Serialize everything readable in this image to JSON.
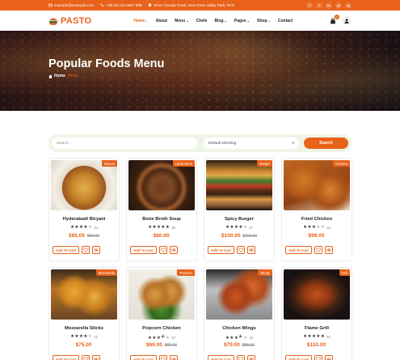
{
  "topbar": {
    "email": "example@example.com",
    "phone": "+88 (0) 123 4567 888",
    "address": "Inner Circular Road, New Rose Valley Park, NYZ",
    "socials": [
      "f",
      "t",
      "in",
      "yt",
      "ig"
    ]
  },
  "header": {
    "logo": "PASTO",
    "nav": [
      {
        "label": "Home",
        "dropdown": true,
        "active": true
      },
      {
        "label": "About",
        "dropdown": false
      },
      {
        "label": "Menu",
        "dropdown": true
      },
      {
        "label": "Chefs",
        "dropdown": false
      },
      {
        "label": "Blog",
        "dropdown": true
      },
      {
        "label": "Pages",
        "dropdown": true
      },
      {
        "label": "Shop",
        "dropdown": true
      },
      {
        "label": "Contact",
        "dropdown": false
      }
    ],
    "cart_count": "0"
  },
  "hero": {
    "title": "Popular Foods Menu",
    "breadcrumb_home": "Home",
    "breadcrumb_current": "Menu"
  },
  "filters": {
    "search_placeholder": "search...",
    "sort_selected": "Default Shorting",
    "search_button": "Search"
  },
  "add_to_cart_label": "Add To Cart",
  "products": [
    {
      "name": "Hyderabadi Biryani",
      "category": "Biryani",
      "stars": 4,
      "reviews": "24",
      "price": "$65.00",
      "old_price": "$80.00"
    },
    {
      "name": "Bone Broth Soup",
      "category": "Lamb Bone",
      "stars": 5,
      "reviews": "30",
      "price": "$80.00",
      "old_price": ""
    },
    {
      "name": "Spicy Burger",
      "category": "Burger",
      "stars": 4,
      "reviews": "17",
      "price": "$100.00",
      "old_price": "$110.00"
    },
    {
      "name": "Fried Chicken",
      "category": "Chicken",
      "stars": 3,
      "reviews": "22",
      "price": "$99.00",
      "old_price": ""
    },
    {
      "name": "Mozzarella Sticks",
      "category": "Mozzarella",
      "stars": 4,
      "reviews": "72",
      "price": "$75.00",
      "old_price": ""
    },
    {
      "name": "Popcorn Chicken",
      "category": "Popcorn",
      "stars": 3.5,
      "reviews": "57",
      "price": "$69.00",
      "old_price": "$80.00"
    },
    {
      "name": "Chicken Wings",
      "category": "Wings",
      "stars": 3.5,
      "reviews": "43",
      "price": "$79.00",
      "old_price": "$85.00"
    },
    {
      "name": "Flame Grill",
      "category": "Grill",
      "stars": 5,
      "reviews": "42",
      "price": "$110.00",
      "old_price": ""
    }
  ]
}
